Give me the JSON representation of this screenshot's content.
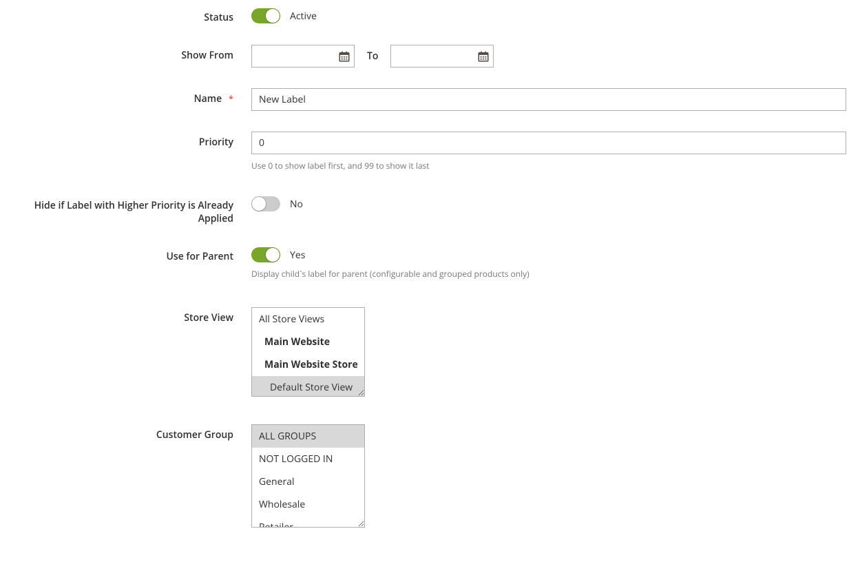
{
  "fields": {
    "status": {
      "label": "Status",
      "value_text": "Active",
      "on": true
    },
    "show_from": {
      "label": "Show From",
      "from_value": "",
      "to_label": "To",
      "to_value": ""
    },
    "name": {
      "label": "Name",
      "value": "New Label",
      "required": true
    },
    "priority": {
      "label": "Priority",
      "value": "0",
      "hint": "Use 0 to show label first, and 99 to show it last"
    },
    "hide_higher": {
      "label": "Hide if Label with Higher Priority is Already Applied",
      "value_text": "No",
      "on": false
    },
    "use_for_parent": {
      "label": "Use for Parent",
      "value_text": "Yes",
      "on": true,
      "hint": "Display child`s label for parent (configurable and grouped products only)"
    },
    "store_view": {
      "label": "Store View",
      "options": [
        {
          "text": "All Store Views",
          "bold": false,
          "indent": 0,
          "selected": false
        },
        {
          "text": "Main Website",
          "bold": true,
          "indent": 1,
          "selected": false
        },
        {
          "text": "Main Website Store",
          "bold": true,
          "indent": 1,
          "selected": false
        },
        {
          "text": "Default Store View",
          "bold": false,
          "indent": 2,
          "selected": true
        }
      ]
    },
    "customer_group": {
      "label": "Customer Group",
      "options": [
        {
          "text": "ALL GROUPS",
          "selected": true
        },
        {
          "text": "NOT LOGGED IN",
          "selected": false
        },
        {
          "text": "General",
          "selected": false
        },
        {
          "text": "Wholesale",
          "selected": false
        },
        {
          "text": "Retailer",
          "selected": false
        }
      ]
    }
  },
  "required_mark": "*"
}
